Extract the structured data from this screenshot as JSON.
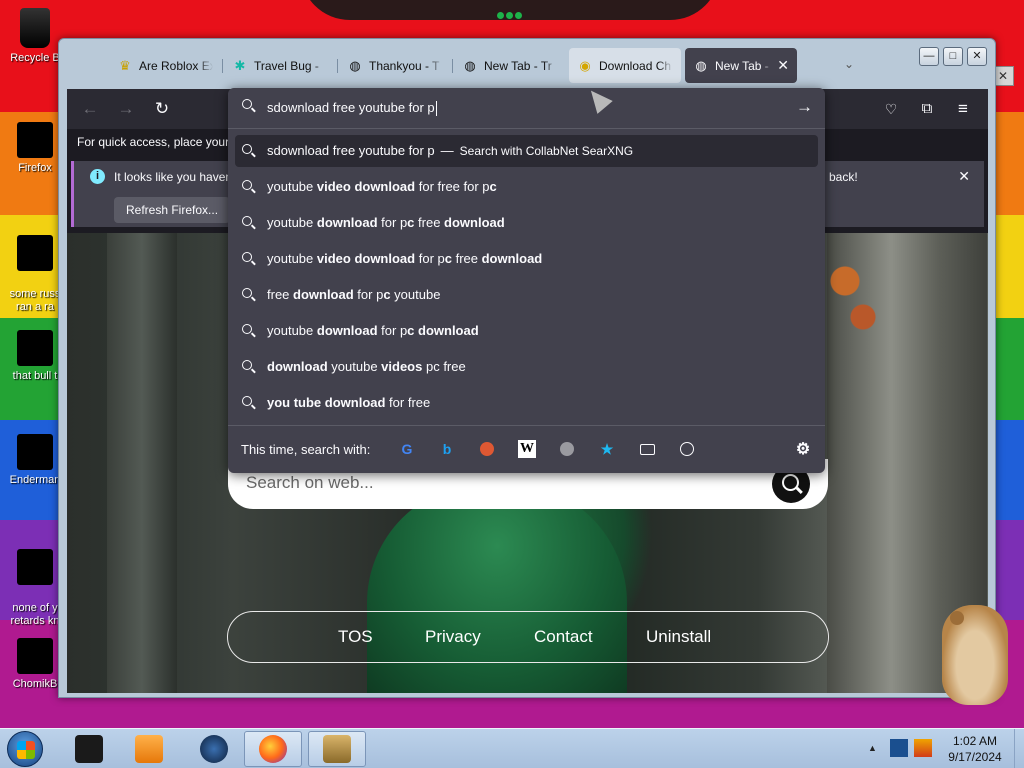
{
  "desktop": {
    "icons": [
      {
        "label": "Recycle B"
      },
      {
        "label": "Firefox"
      },
      {
        "label": "some russ\nran a ra"
      },
      {
        "label": "that bull t"
      },
      {
        "label": "Enderman"
      },
      {
        "label": "none of y\nretards kn"
      },
      {
        "label": "ChomikB"
      }
    ]
  },
  "browser": {
    "tabs": [
      {
        "label": "Are Roblox Ex",
        "icon": "crown-icon"
      },
      {
        "label": "Travel Bug - ",
        "icon": "puzzle-icon"
      },
      {
        "label": "Thankyou - T",
        "icon": "globe-icon"
      },
      {
        "label": "New Tab - Tr",
        "icon": "globe-icon"
      },
      {
        "label": "Download Ch",
        "icon": "download-app-icon"
      },
      {
        "label": "New Tab - ",
        "icon": "globe-icon"
      }
    ],
    "window_controls": {
      "minimize": "—",
      "maximize": "□",
      "close": "✕"
    },
    "quick_access": "For quick access, place your b",
    "notice": {
      "message": "It looks like you haven",
      "message_tail": "back!",
      "refresh_button": "Refresh Firefox..."
    },
    "urlbar": {
      "value": "sdownload free youtube for p",
      "suggestions": [
        {
          "parts": [
            [
              "sdownload free youtube for p",
              false
            ]
          ],
          "engine_sep": "—",
          "engine": "Search with CollabNet SearXNG",
          "selected": true
        },
        {
          "parts": [
            [
              "youtube ",
              false
            ],
            [
              "video download",
              true
            ],
            [
              " for free for p",
              false
            ],
            [
              "c",
              true
            ]
          ]
        },
        {
          "parts": [
            [
              "youtube ",
              false
            ],
            [
              "download",
              true
            ],
            [
              " for p",
              false
            ],
            [
              "c",
              true
            ],
            [
              " free ",
              false
            ],
            [
              "download",
              true
            ]
          ]
        },
        {
          "parts": [
            [
              "youtube ",
              false
            ],
            [
              "video download",
              true
            ],
            [
              " for p",
              false
            ],
            [
              "c",
              true
            ],
            [
              " free ",
              false
            ],
            [
              "download",
              true
            ]
          ]
        },
        {
          "parts": [
            [
              "free ",
              false
            ],
            [
              "download",
              true
            ],
            [
              " for p",
              false
            ],
            [
              "c",
              true
            ],
            [
              " youtube",
              false
            ]
          ]
        },
        {
          "parts": [
            [
              "youtube ",
              false
            ],
            [
              "download",
              true
            ],
            [
              " for p",
              false
            ],
            [
              "c download",
              true
            ]
          ]
        },
        {
          "parts": [
            [
              "download",
              true
            ],
            [
              " youtube ",
              false
            ],
            [
              "videos",
              true
            ],
            [
              " pc free",
              false
            ]
          ]
        },
        {
          "parts": [
            [
              "you tube download",
              true
            ],
            [
              " for free",
              false
            ]
          ]
        }
      ],
      "one_off_label": "This time, search with:",
      "one_off_engines": [
        "google-icon",
        "bing-icon",
        "duckduckgo-icon",
        "wikipedia-icon",
        "searxng-icon",
        "bookmarks-icon",
        "tabs-icon",
        "history-icon",
        "settings-icon"
      ]
    },
    "page": {
      "search_placeholder": "Search on web...",
      "footer_links": [
        "TOS",
        "Privacy",
        "Contact",
        "Uninstall"
      ]
    }
  },
  "taskbar": {
    "clock_time": "1:02 AM",
    "clock_date": "9/17/2024"
  },
  "colors": {
    "toolbar_bg": "#2b2a33",
    "panel_bg": "#42414d",
    "text_light": "#fbfbfe",
    "accent_info": "#80ebff"
  }
}
